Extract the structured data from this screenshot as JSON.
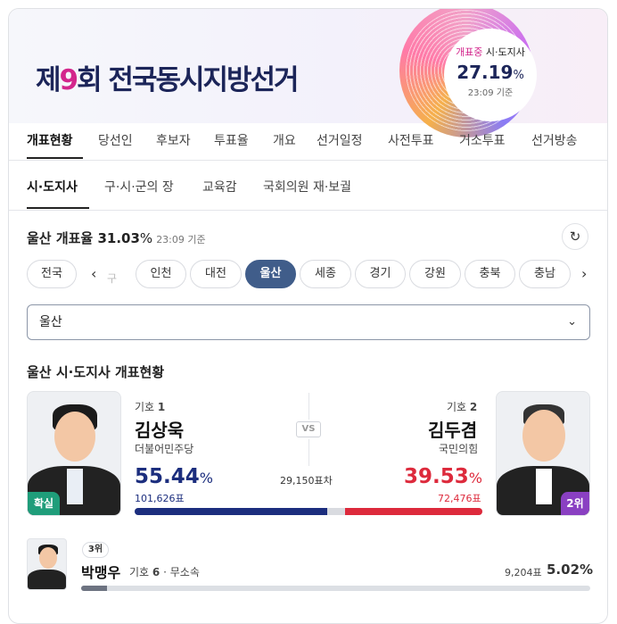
{
  "header": {
    "title_pre": "제",
    "title_num": "9",
    "title_post": "회 전국동시지방선거",
    "badge": {
      "label_hl": "개표중",
      "label_rest": " 시·도지사",
      "percent": "27.19",
      "unit": "%",
      "time": "23:09 기준"
    }
  },
  "tabs": [
    "개표현황",
    "당선인",
    "후보자",
    "투표율",
    "개요",
    "선거일정",
    "사전투표",
    "거소투표",
    "선거방송"
  ],
  "subtabs": [
    "시·도지사",
    "구·시·군의 장",
    "교육감",
    "국회의원 재·보궐"
  ],
  "region": {
    "rate_label": "울산 개표율",
    "rate_value": "31.03",
    "rate_unit": "%",
    "rate_time": "23:09 기준",
    "chips": [
      "전국",
      "구",
      "인천",
      "대전",
      "울산",
      "세종",
      "경기",
      "강원",
      "충북",
      "충남"
    ],
    "selected_chip": "울산",
    "select_value": "울산",
    "section_title": "울산 시·도지사 개표현황"
  },
  "candidates": {
    "first": {
      "number_label": "기호",
      "number": "1",
      "name": "김상욱",
      "party": "더불어민주당",
      "percent": "55.44",
      "unit": "%",
      "votes": "101,626표",
      "status": "확실"
    },
    "second": {
      "number_label": "기호",
      "number": "2",
      "name": "김두겸",
      "party": "국민의힘",
      "percent": "39.53",
      "unit": "%",
      "votes": "72,476표",
      "rank": "2위"
    },
    "vs": "VS",
    "diff": "29,150표차",
    "third": {
      "rank": "3위",
      "name": "박맹우",
      "number_label": "기호",
      "number": "6",
      "party": "무소속",
      "votes": "9,204표",
      "percent": "5.02%"
    }
  },
  "colors": {
    "accent_navy": "#1c2559",
    "party1": "#1c2e7e",
    "party2": "#dd2a3c",
    "win": "#1f9d7a",
    "rank2": "#8a40c2",
    "chip_active": "#405d8a"
  },
  "bar_fractions": {
    "first": 0.5544,
    "second": 0.3953,
    "third": 0.0502
  }
}
